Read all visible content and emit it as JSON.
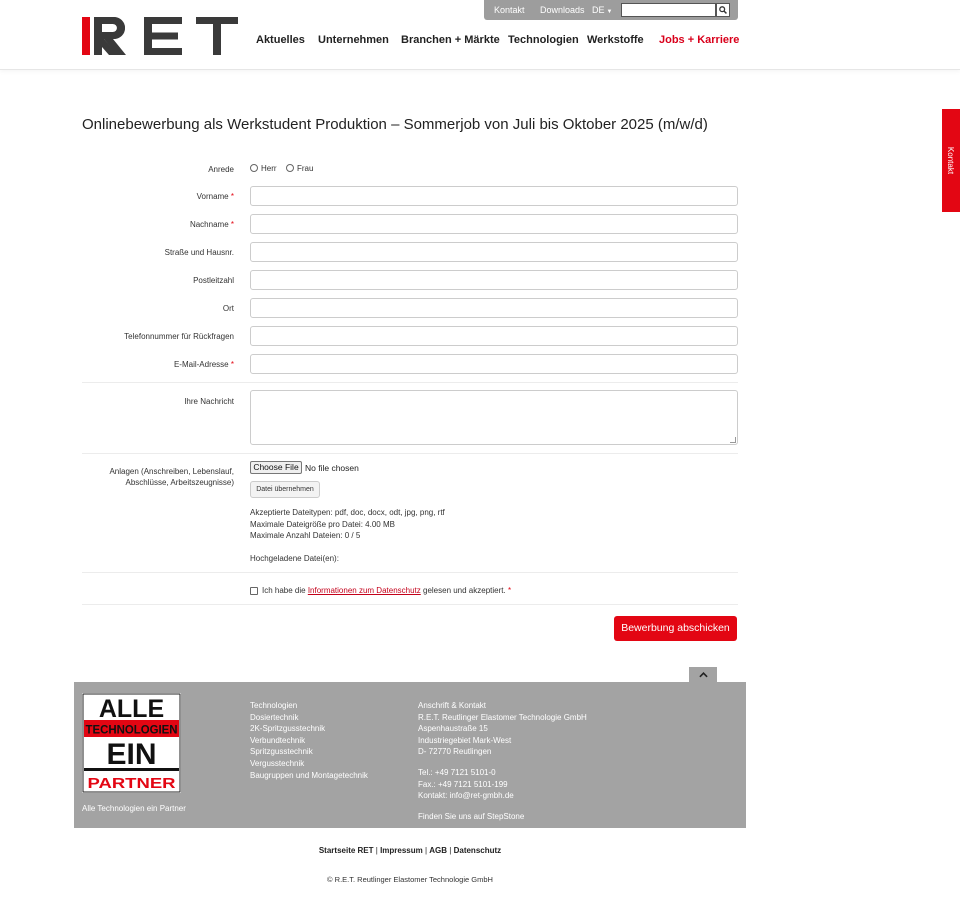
{
  "header": {
    "logo_text": "RET",
    "top_links": [
      "Kontakt",
      "Downloads",
      "DE"
    ],
    "search_placeholder": "",
    "nav": [
      "Aktuelles",
      "Unternehmen",
      "Branchen + Märkte",
      "Technologien",
      "Werkstoffe",
      "Jobs + Karriere"
    ]
  },
  "side_tab": "Kontakt",
  "page_title": "Onlinebewerbung als Werkstudent Produktion – Sommerjob von Juli bis Oktober 2025 (m/w/d)",
  "form": {
    "salutation_label": "Anrede",
    "salutation_options": [
      "Herr",
      "Frau"
    ],
    "fields": [
      {
        "label": "Vorname",
        "required": "*"
      },
      {
        "label": "Nachname",
        "required": "*"
      },
      {
        "label": "Straße und Hausnr.",
        "required": ""
      },
      {
        "label": "Postleitzahl",
        "required": ""
      },
      {
        "label": "Ort",
        "required": ""
      },
      {
        "label": "Telefonnummer für Rückfragen",
        "required": ""
      },
      {
        "label": "E-Mail-Adresse",
        "required": "*"
      }
    ],
    "message_label": "Ihre Nachricht",
    "attachments_label_1": "Anlagen (Anschreiben, Lebenslauf,",
    "attachments_label_2": "Abschlüsse, Arbeitszeugnisse)",
    "choose_file": "Choose File",
    "no_file": "No file chosen",
    "upload_button": "Datei übernehmen",
    "accepted_types": "Akzeptierte Dateitypen: pdf, doc, docx, odt, jpg, png, rtf",
    "max_size": "Maximale Dateigröße pro Datei: 4.00 MB",
    "max_files": "Maximale Anzahl Dateien: 0 / 5",
    "uploaded": "Hochgeladene Datei(en):",
    "consent_prefix": "Ich habe die ",
    "consent_link": "Informationen zum Datenschutz",
    "consent_suffix": " gelesen und akzeptiert.",
    "consent_required": "*",
    "submit": "Bewerbung abschicken"
  },
  "footer": {
    "logo_lines": [
      "ALLE",
      "TECHNOLOGIEN",
      "EIN",
      "PARTNER"
    ],
    "tagline": "Alle Technologien ein Partner",
    "technologies": [
      "Technologien",
      "Dosiertechnik",
      "2K-Spritzgusstechnik",
      "Verbundtechnik",
      "Spritzgusstechnik",
      "Vergusstechnik",
      "Baugruppen und Montagetechnik"
    ],
    "address": [
      "Anschrift & Kontakt",
      "R.E.T. Reutlinger Elastomer Technologie GmbH",
      "Aspenhaustraße 15",
      "Industriegebiet Mark-West",
      "D- 72770 Reutlingen"
    ],
    "contact": [
      "Tel.: +49 7121 5101-0",
      "Fax.: +49 7121 5101-199",
      "Kontakt: info@ret-gmbh.de"
    ],
    "stepstone": "Finden Sie uns auf StepStone"
  },
  "bottom_links": [
    "Startseite RET",
    "Impressum",
    "AGB",
    "Datenschutz"
  ],
  "copyright": "© R.E.T. Reutlinger Elastomer Technologie GmbH",
  "colors": {
    "accent": "#e30613",
    "footer": "#a3a3a3",
    "topbar": "#9d9d9d"
  }
}
